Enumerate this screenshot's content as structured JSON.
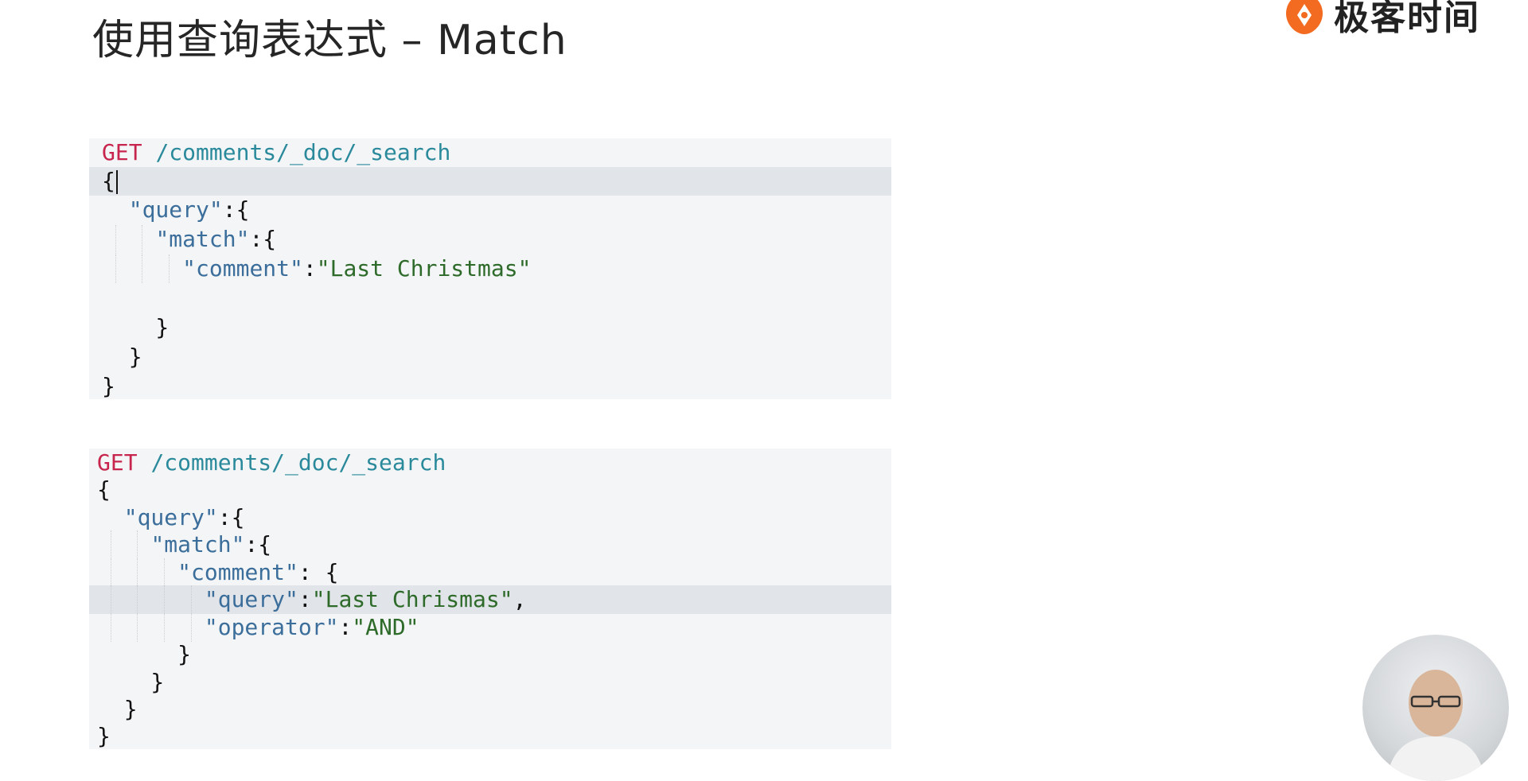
{
  "slide": {
    "title": "使用查询表达式 – Match"
  },
  "brand": {
    "name": "极客时间",
    "accent": "#f26b21"
  },
  "code_blocks": [
    {
      "lines": [
        {
          "tokens": [
            {
              "t": "GET ",
              "c": "method"
            },
            {
              "t": "/comments/_doc/_search",
              "c": "path"
            }
          ]
        },
        {
          "tokens": [
            {
              "t": "{",
              "c": "punct"
            }
          ]
        },
        {
          "tokens": [
            {
              "t": "  ",
              "c": "punct"
            },
            {
              "t": "\"query\"",
              "c": "key"
            },
            {
              "t": ":{",
              "c": "punct"
            }
          ]
        },
        {
          "tokens": [
            {
              "t": "    ",
              "c": "punct"
            },
            {
              "t": "\"match\"",
              "c": "key"
            },
            {
              "t": ":{",
              "c": "punct"
            }
          ]
        },
        {
          "tokens": [
            {
              "t": "      ",
              "c": "punct"
            },
            {
              "t": "\"comment\"",
              "c": "key"
            },
            {
              "t": ":",
              "c": "punct"
            },
            {
              "t": "\"Last Christmas\"",
              "c": "str"
            }
          ]
        },
        {
          "tokens": []
        },
        {
          "tokens": [
            {
              "t": "    }",
              "c": "punct"
            }
          ]
        },
        {
          "tokens": [
            {
              "t": "  }",
              "c": "punct"
            }
          ]
        },
        {
          "tokens": [
            {
              "t": "}",
              "c": "punct"
            }
          ]
        }
      ]
    },
    {
      "lines": [
        {
          "tokens": [
            {
              "t": "GET ",
              "c": "method"
            },
            {
              "t": "/comments/_doc/_search",
              "c": "path"
            }
          ]
        },
        {
          "tokens": [
            {
              "t": "{",
              "c": "punct"
            }
          ]
        },
        {
          "tokens": [
            {
              "t": "  ",
              "c": "punct"
            },
            {
              "t": "\"query\"",
              "c": "key"
            },
            {
              "t": ":{",
              "c": "punct"
            }
          ]
        },
        {
          "tokens": [
            {
              "t": "    ",
              "c": "punct"
            },
            {
              "t": "\"match\"",
              "c": "key"
            },
            {
              "t": ":{",
              "c": "punct"
            }
          ]
        },
        {
          "tokens": [
            {
              "t": "      ",
              "c": "punct"
            },
            {
              "t": "\"comment\"",
              "c": "key"
            },
            {
              "t": ": {",
              "c": "punct"
            }
          ]
        },
        {
          "tokens": [
            {
              "t": "        ",
              "c": "punct"
            },
            {
              "t": "\"query\"",
              "c": "key"
            },
            {
              "t": ":",
              "c": "punct"
            },
            {
              "t": "\"Last Chrismas\"",
              "c": "str"
            },
            {
              "t": ",",
              "c": "punct"
            }
          ]
        },
        {
          "tokens": [
            {
              "t": "        ",
              "c": "punct"
            },
            {
              "t": "\"operator\"",
              "c": "key"
            },
            {
              "t": ":",
              "c": "punct"
            },
            {
              "t": "\"AND\"",
              "c": "str"
            }
          ]
        },
        {
          "tokens": [
            {
              "t": "      }",
              "c": "punct"
            }
          ]
        },
        {
          "tokens": [
            {
              "t": "    }",
              "c": "punct"
            }
          ]
        },
        {
          "tokens": [
            {
              "t": "  }",
              "c": "punct"
            }
          ]
        },
        {
          "tokens": [
            {
              "t": "}",
              "c": "punct"
            }
          ]
        }
      ]
    }
  ]
}
